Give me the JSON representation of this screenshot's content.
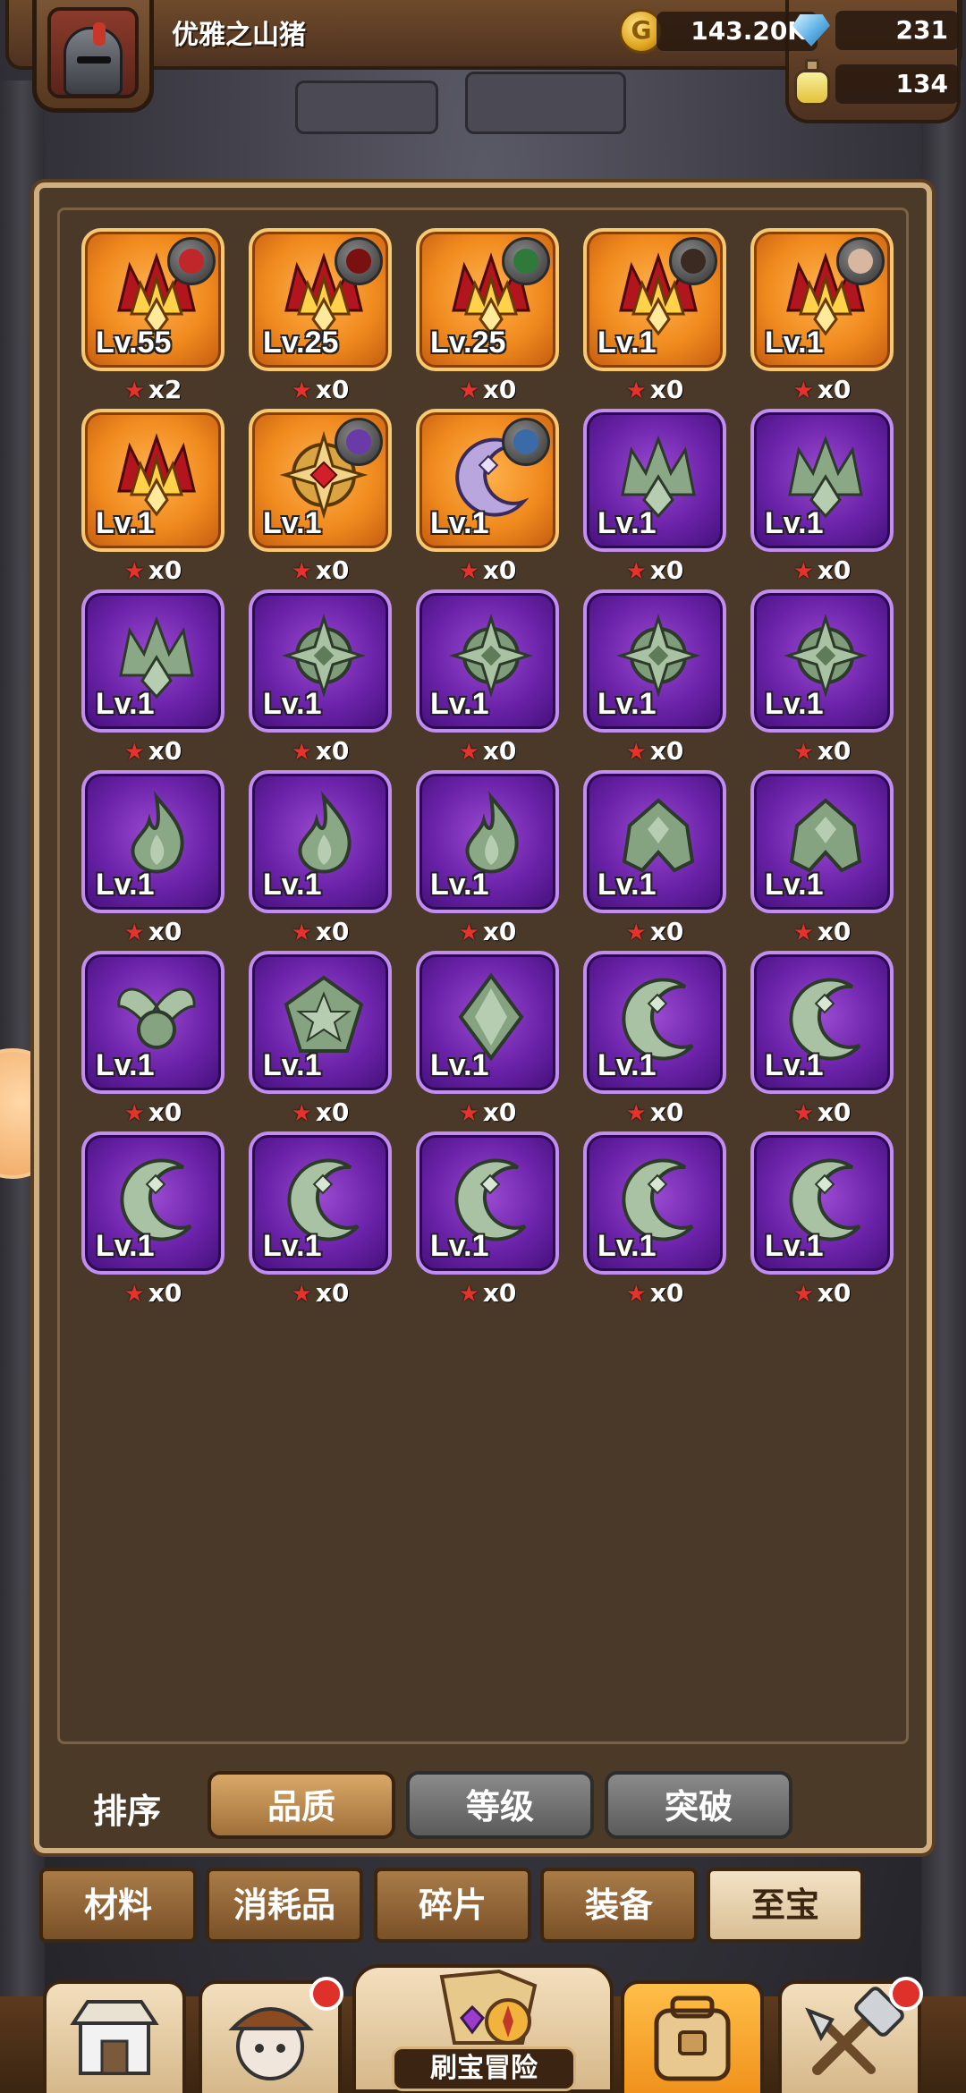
{
  "header": {
    "username": "优雅之山猪",
    "coins": "143.20K",
    "gems": "231",
    "potions": "134"
  },
  "items": [
    {
      "rarity": "orange",
      "art": "flame-crown",
      "badge": "red-devil",
      "level": "Lv.55",
      "count": "x2"
    },
    {
      "rarity": "orange",
      "art": "flame-crown",
      "badge": "dark-red-devil",
      "level": "Lv.25",
      "count": "x0"
    },
    {
      "rarity": "orange",
      "art": "flame-crown",
      "badge": "green-hood",
      "level": "Lv.25",
      "count": "x0"
    },
    {
      "rarity": "orange",
      "art": "flame-crown",
      "badge": "dark-beast",
      "level": "Lv.1",
      "count": "x0"
    },
    {
      "rarity": "orange",
      "art": "flame-crown",
      "badge": "pale-face",
      "level": "Lv.1",
      "count": "x0"
    },
    {
      "rarity": "orange",
      "art": "flame-crown",
      "badge": "",
      "level": "Lv.1",
      "count": "x0"
    },
    {
      "rarity": "orange",
      "art": "golden-cross",
      "badge": "purple-wizard",
      "level": "Lv.1",
      "count": "x0"
    },
    {
      "rarity": "orange",
      "art": "moon-pendant",
      "badge": "blue-hood",
      "level": "Lv.1",
      "count": "x0"
    },
    {
      "rarity": "purple",
      "art": "jade-crown",
      "badge": "",
      "level": "Lv.1",
      "count": "x0"
    },
    {
      "rarity": "purple",
      "art": "jade-crown",
      "badge": "",
      "level": "Lv.1",
      "count": "x0"
    },
    {
      "rarity": "purple",
      "art": "jade-crown",
      "badge": "",
      "level": "Lv.1",
      "count": "x0"
    },
    {
      "rarity": "purple",
      "art": "jade-cross",
      "badge": "",
      "level": "Lv.1",
      "count": "x0"
    },
    {
      "rarity": "purple",
      "art": "jade-cross",
      "badge": "",
      "level": "Lv.1",
      "count": "x0"
    },
    {
      "rarity": "purple",
      "art": "jade-cross",
      "badge": "",
      "level": "Lv.1",
      "count": "x0"
    },
    {
      "rarity": "purple",
      "art": "jade-cross",
      "badge": "",
      "level": "Lv.1",
      "count": "x0"
    },
    {
      "rarity": "purple",
      "art": "jade-flame",
      "badge": "",
      "level": "Lv.1",
      "count": "x0"
    },
    {
      "rarity": "purple",
      "art": "jade-flame",
      "badge": "",
      "level": "Lv.1",
      "count": "x0"
    },
    {
      "rarity": "purple",
      "art": "jade-flame",
      "badge": "",
      "level": "Lv.1",
      "count": "x0"
    },
    {
      "rarity": "purple",
      "art": "jade-helm",
      "badge": "",
      "level": "Lv.1",
      "count": "x0"
    },
    {
      "rarity": "purple",
      "art": "jade-helm",
      "badge": "",
      "level": "Lv.1",
      "count": "x0"
    },
    {
      "rarity": "purple",
      "art": "jade-wings",
      "badge": "",
      "level": "Lv.1",
      "count": "x0"
    },
    {
      "rarity": "purple",
      "art": "jade-star",
      "badge": "",
      "level": "Lv.1",
      "count": "x0"
    },
    {
      "rarity": "purple",
      "art": "jade-spike",
      "badge": "",
      "level": "Lv.1",
      "count": "x0"
    },
    {
      "rarity": "purple",
      "art": "jade-moon",
      "badge": "",
      "level": "Lv.1",
      "count": "x0"
    },
    {
      "rarity": "purple",
      "art": "jade-moon",
      "badge": "",
      "level": "Lv.1",
      "count": "x0"
    },
    {
      "rarity": "purple",
      "art": "jade-moon",
      "badge": "",
      "level": "Lv.1",
      "count": "x0"
    },
    {
      "rarity": "purple",
      "art": "jade-moon",
      "badge": "",
      "level": "Lv.1",
      "count": "x0"
    },
    {
      "rarity": "purple",
      "art": "jade-moon",
      "badge": "",
      "level": "Lv.1",
      "count": "x0"
    },
    {
      "rarity": "purple",
      "art": "jade-moon",
      "badge": "",
      "level": "Lv.1",
      "count": "x0"
    },
    {
      "rarity": "purple",
      "art": "jade-moon",
      "badge": "",
      "level": "Lv.1",
      "count": "x0"
    }
  ],
  "sort": {
    "label": "排序",
    "options": [
      "品质",
      "等级",
      "突破"
    ],
    "active": "品质"
  },
  "categories": {
    "tabs": [
      "材料",
      "消耗品",
      "碎片",
      "装备",
      "至宝"
    ],
    "active": "至宝"
  },
  "bottom_nav": {
    "center_label": "刷宝冒险",
    "items": [
      "shop-icon",
      "hero-icon",
      "adventure-map-icon",
      "backpack-icon",
      "forge-icon"
    ],
    "active": "backpack-icon"
  },
  "colors": {
    "orange_rarity": "#f08a1e",
    "purple_rarity": "#6a22a8",
    "star": "#e5322c",
    "active_tab": "#d9bf94"
  }
}
